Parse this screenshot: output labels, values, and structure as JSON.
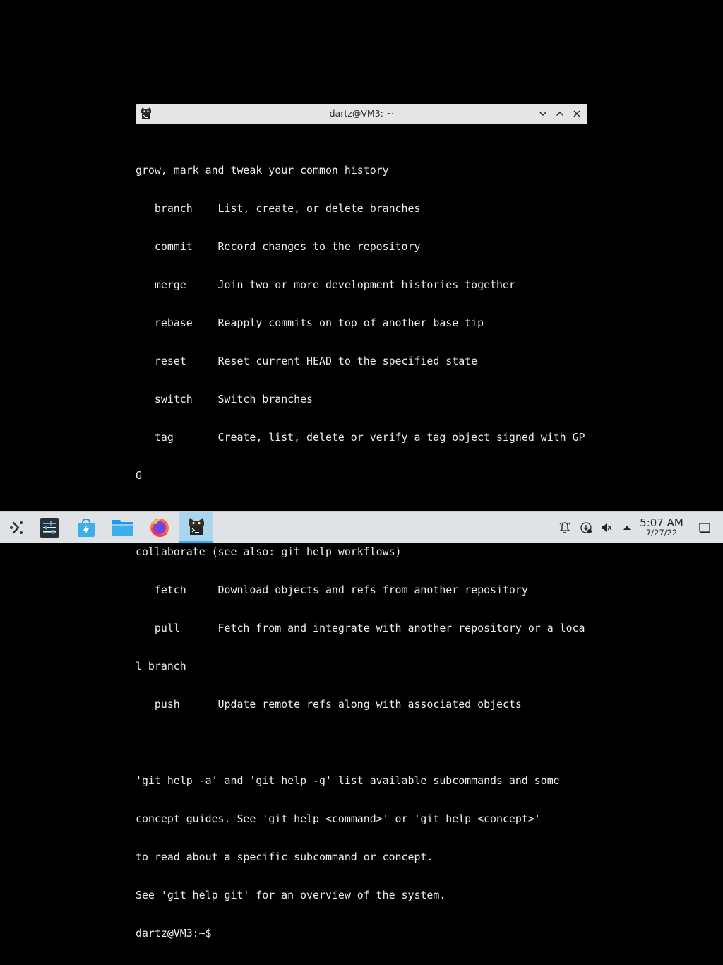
{
  "window": {
    "title": "dartz@VM3: ~"
  },
  "terminal": {
    "lines": [
      "grow, mark and tweak your common history",
      "   branch    List, create, or delete branches",
      "   commit    Record changes to the repository",
      "   merge     Join two or more development histories together",
      "   rebase    Reapply commits on top of another base tip",
      "   reset     Reset current HEAD to the specified state",
      "   switch    Switch branches",
      "   tag       Create, list, delete or verify a tag object signed with GP",
      "G",
      "",
      "collaborate (see also: git help workflows)",
      "   fetch     Download objects and refs from another repository",
      "   pull      Fetch from and integrate with another repository or a loca",
      "l branch",
      "   push      Update remote refs along with associated objects",
      "",
      "'git help -a' and 'git help -g' list available subcommands and some",
      "concept guides. See 'git help <command>' or 'git help <concept>'",
      "to read about a specific subcommand or concept.",
      "See 'git help git' for an overview of the system.",
      "dartz@VM3:~$ "
    ]
  },
  "taskbar": {
    "items": [
      {
        "icon": "application-launcher-icon"
      },
      {
        "icon": "system-settings-icon"
      },
      {
        "icon": "discover-store-icon"
      },
      {
        "icon": "file-manager-icon"
      },
      {
        "icon": "firefox-icon"
      },
      {
        "icon": "konsole-terminal-icon",
        "active": true
      }
    ],
    "tray": [
      {
        "icon": "notifications-icon"
      },
      {
        "icon": "updates-icon"
      },
      {
        "icon": "volume-muted-icon"
      },
      {
        "icon": "tray-expand-icon"
      }
    ],
    "clock": {
      "time": "5:07 AM",
      "date": "7/27/22"
    }
  },
  "colors": {
    "titlebar": "#e3e5e7",
    "terminal_bg": "#000000",
    "terminal_fg": "#eeeeee",
    "taskbar": "#e0e3e6",
    "active_task": "#a9d6ec",
    "accent": "#3daee9"
  }
}
